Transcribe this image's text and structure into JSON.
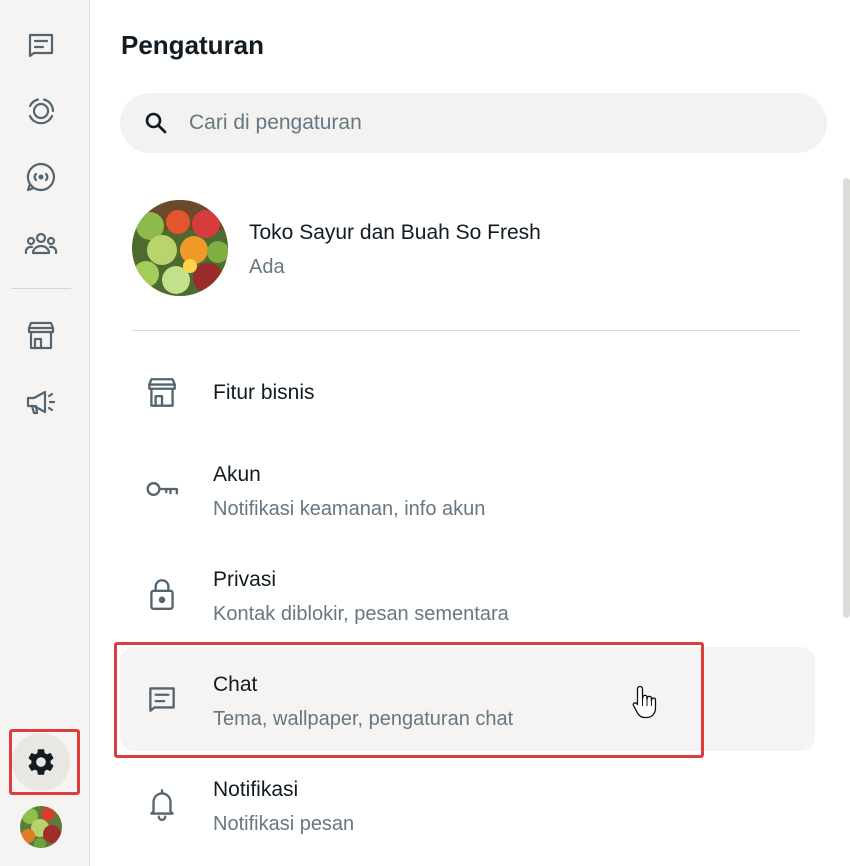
{
  "rail": {
    "items": [
      {
        "name": "chats",
        "icon": "chat-icon"
      },
      {
        "name": "status",
        "icon": "status-icon"
      },
      {
        "name": "channels",
        "icon": "channels-icon"
      },
      {
        "name": "communities",
        "icon": "communities-icon"
      },
      {
        "name": "business-tools",
        "icon": "store-icon"
      },
      {
        "name": "advertise",
        "icon": "megaphone-icon"
      }
    ],
    "settings_icon": "gear-icon",
    "profile_icon": "avatar"
  },
  "header": {
    "title": "Pengaturan"
  },
  "search": {
    "placeholder": "Cari di pengaturan",
    "value": ""
  },
  "profile": {
    "name": "Toko Sayur dan Buah So Fresh",
    "status": "Ada"
  },
  "settings_items": [
    {
      "label": "Fitur bisnis",
      "sub": "",
      "icon": "store-icon"
    },
    {
      "label": "Akun",
      "sub": "Notifikasi keamanan, info akun",
      "icon": "key-icon"
    },
    {
      "label": "Privasi",
      "sub": "Kontak diblokir, pesan sementara",
      "icon": "lock-icon"
    },
    {
      "label": "Chat",
      "sub": "Tema, wallpaper, pengaturan chat",
      "icon": "chat-icon",
      "active": true
    },
    {
      "label": "Notifikasi",
      "sub": "Notifikasi pesan",
      "icon": "bell-icon"
    }
  ],
  "colors": {
    "highlight_border": "#dc3e3e",
    "rail_bg": "#f5f4f2",
    "icon": "#54656f",
    "secondary_text": "#667781"
  }
}
